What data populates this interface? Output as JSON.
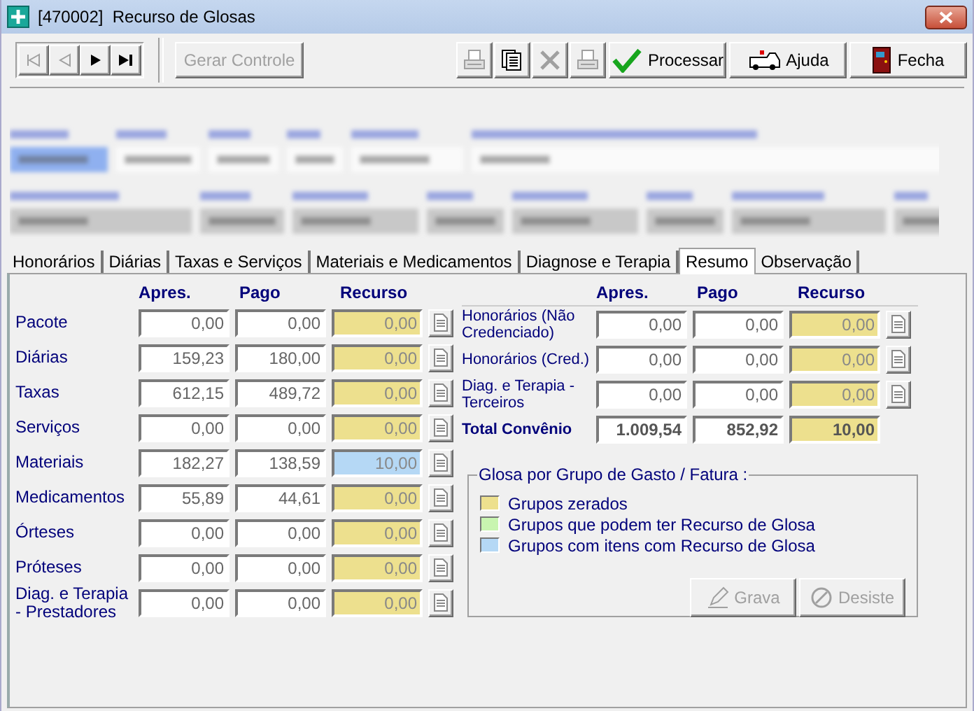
{
  "window": {
    "title": "[470002]  Recurso de Glosas"
  },
  "toolbar": {
    "nav": [
      {
        "kind": "first",
        "disabled": true
      },
      {
        "kind": "prev",
        "disabled": true
      },
      {
        "kind": "next",
        "disabled": false
      },
      {
        "kind": "last",
        "disabled": false
      }
    ],
    "generate": {
      "label": "Gerar Controle",
      "disabled": true
    },
    "icon_buttons": [
      {
        "kind": "print-preview",
        "disabled": true
      },
      {
        "kind": "copy",
        "disabled": false
      },
      {
        "kind": "delete",
        "disabled": true
      },
      {
        "kind": "print",
        "disabled": true
      }
    ],
    "actions": [
      {
        "kind": "check",
        "label": "Processar"
      },
      {
        "kind": "ambulance",
        "label": "Ajuda"
      },
      {
        "kind": "door",
        "label": "Fecha"
      }
    ]
  },
  "tabs": [
    {
      "label": "Honorários",
      "selected": false
    },
    {
      "label": "Diárias",
      "selected": false
    },
    {
      "label": "Taxas e Serviços",
      "selected": false
    },
    {
      "label": "Materiais e Medicamentos",
      "selected": false
    },
    {
      "label": "Diagnose e Terapia",
      "selected": false
    },
    {
      "label": "Resumo",
      "selected": true
    },
    {
      "label": "Observação",
      "selected": false
    }
  ],
  "summary": {
    "left_columns": [
      "Apres.",
      "Pago",
      "Recurso"
    ],
    "right_columns": [
      "Apres.",
      "Pago",
      "Recurso"
    ],
    "left_rows": [
      {
        "label": "Pacote",
        "apres": "0,00",
        "pago": "0,00",
        "recurso": "0,00",
        "color": "#ede08e"
      },
      {
        "label": "Diárias",
        "apres": "159,23",
        "pago": "180,00",
        "recurso": "0,00",
        "color": "#ede08e"
      },
      {
        "label": "Taxas",
        "apres": "612,15",
        "pago": "489,72",
        "recurso": "0,00",
        "color": "#ede08e"
      },
      {
        "label": "Serviços",
        "apres": "0,00",
        "pago": "0,00",
        "recurso": "0,00",
        "color": "#ede08e"
      },
      {
        "label": "Materiais",
        "apres": "182,27",
        "pago": "138,59",
        "recurso": "10,00",
        "color": "#b5d8f5"
      },
      {
        "label": "Medicamentos",
        "apres": "55,89",
        "pago": "44,61",
        "recurso": "0,00",
        "color": "#ede08e"
      },
      {
        "label": "Órteses",
        "apres": "0,00",
        "pago": "0,00",
        "recurso": "0,00",
        "color": "#ede08e"
      },
      {
        "label": "Próteses",
        "apres": "0,00",
        "pago": "0,00",
        "recurso": "0,00",
        "color": "#ede08e"
      },
      {
        "label": "Diag. e Terapia - Prestadores",
        "apres": "0,00",
        "pago": "0,00",
        "recurso": "0,00",
        "color": "#ede08e"
      }
    ],
    "right_rows": [
      {
        "kind": "group",
        "label": "Honorários (Não Credenciado)",
        "apres": "0,00",
        "pago": "0,00",
        "recurso": "0,00",
        "color": "#ede08e"
      },
      {
        "kind": "group",
        "label": "Honorários (Cred.)",
        "apres": "0,00",
        "pago": "0,00",
        "recurso": "0,00",
        "color": "#ede08e"
      },
      {
        "kind": "group",
        "label": "Diag. e Terapia - Terceiros",
        "apres": "0,00",
        "pago": "0,00",
        "recurso": "0,00",
        "color": "#ede08e"
      },
      {
        "kind": "total",
        "label": "Total Convênio",
        "apres": "1.009,54",
        "pago": "852,92",
        "recurso": "10,00",
        "color": "#ede08e"
      }
    ]
  },
  "legend": {
    "title": "Glosa por Grupo de Gasto / Fatura :",
    "items": [
      {
        "label": "Grupos zerados",
        "color": "#ede08e"
      },
      {
        "label": "Grupos que podem ter Recurso de Glosa",
        "color": "#c8f5b0"
      },
      {
        "label": "Grupos com itens com Recurso de Glosa",
        "color": "#b5d8f5"
      }
    ],
    "buttons": [
      {
        "kind": "save",
        "label": "Grava",
        "disabled": true
      },
      {
        "kind": "cancel",
        "label": "Desiste",
        "disabled": true
      }
    ]
  }
}
